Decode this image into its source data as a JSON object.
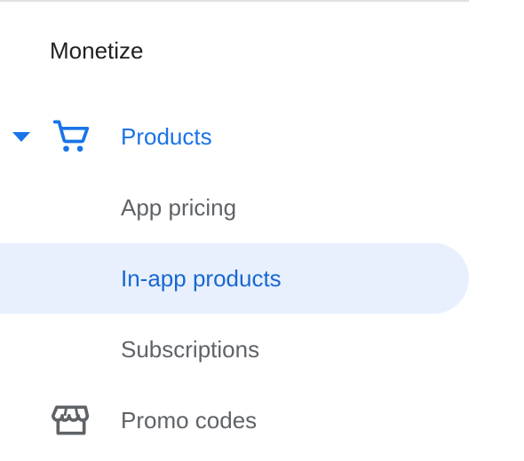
{
  "section": {
    "title": "Monetize"
  },
  "nav": {
    "products": {
      "label": "Products",
      "icon": "shopping-cart-icon",
      "expanded": true
    },
    "sub_items": [
      {
        "label": "App pricing",
        "active": false
      },
      {
        "label": "In-app products",
        "active": true
      },
      {
        "label": "Subscriptions",
        "active": false
      }
    ],
    "promo": {
      "label": "Promo codes",
      "icon": "storefront-icon"
    }
  },
  "colors": {
    "accent": "#1a73e8",
    "active_bg": "#e8f0fe",
    "active_text": "#1967d2",
    "text_secondary": "#5f6368",
    "text_primary": "#202124"
  }
}
